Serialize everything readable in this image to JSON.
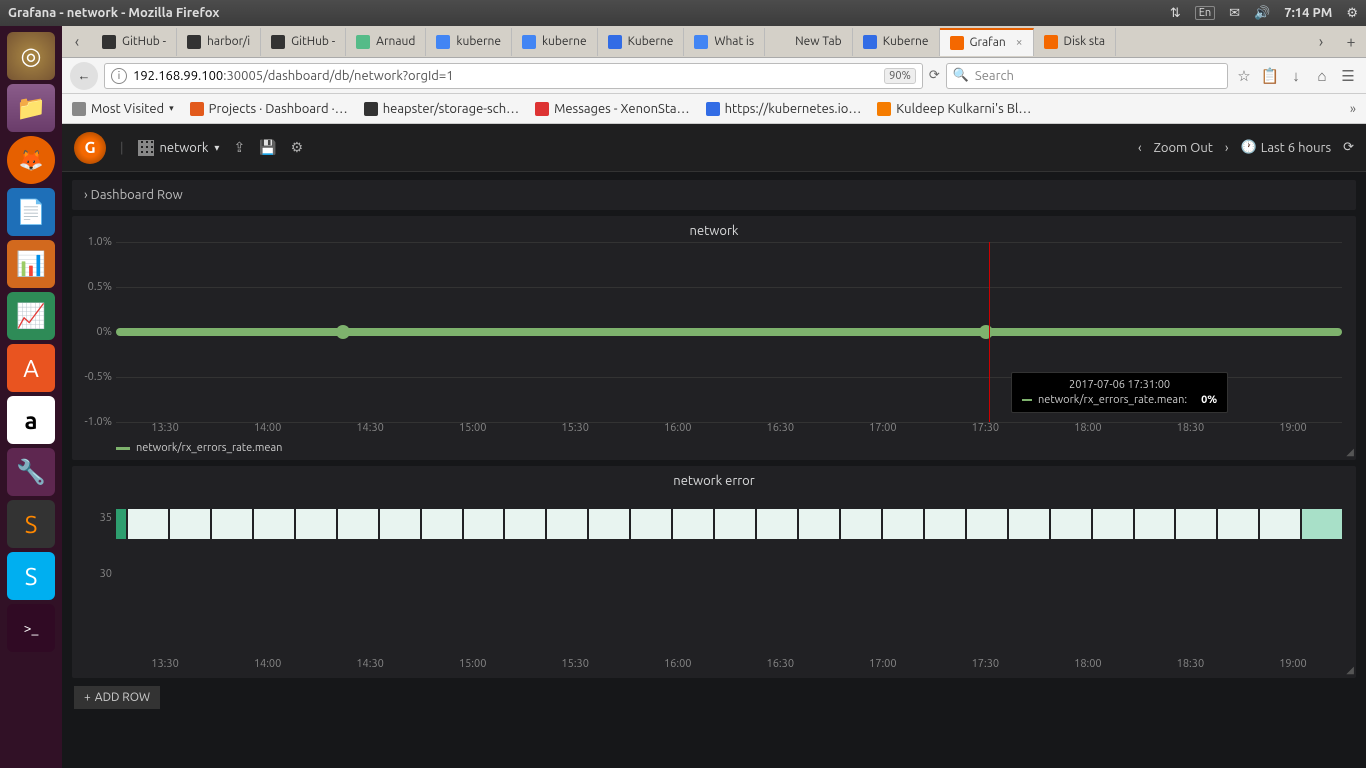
{
  "os": {
    "window_title": "Grafana - network - Mozilla Firefox",
    "indicators": {
      "net": "⇅",
      "lang": "En",
      "mail": "✉",
      "sound": "🔊",
      "time": "7:14 PM",
      "gear": "⚙"
    }
  },
  "launcher": [
    {
      "name": "dash",
      "glyph": "◎"
    },
    {
      "name": "files",
      "glyph": "📁"
    },
    {
      "name": "firefox",
      "glyph": "🦊"
    },
    {
      "name": "writer",
      "glyph": "📄"
    },
    {
      "name": "impress",
      "glyph": "📊"
    },
    {
      "name": "calc",
      "glyph": "📈"
    },
    {
      "name": "software",
      "glyph": "A"
    },
    {
      "name": "amazon",
      "glyph": "a"
    },
    {
      "name": "settings",
      "glyph": "🔧"
    },
    {
      "name": "sublime",
      "glyph": "S"
    },
    {
      "name": "skype",
      "glyph": "S"
    },
    {
      "name": "terminal",
      "glyph": ">_"
    }
  ],
  "tabs": [
    {
      "label": "GitHub -",
      "color": "#333"
    },
    {
      "label": "harbor/i",
      "color": "#333"
    },
    {
      "label": "GitHub -",
      "color": "#333"
    },
    {
      "label": "Arnaud",
      "color": "#5b8"
    },
    {
      "label": "kuberne",
      "color": "#4285f4"
    },
    {
      "label": "kuberne",
      "color": "#4285f4"
    },
    {
      "label": "Kuberne",
      "color": "#326ce5"
    },
    {
      "label": "What is",
      "color": "#4285f4"
    },
    {
      "label": "New Tab",
      "color": "transparent"
    },
    {
      "label": "Kuberne",
      "color": "#326ce5"
    },
    {
      "label": "Grafan",
      "color": "#f46800",
      "active": true,
      "close": true
    },
    {
      "label": "Disk sta",
      "color": "#f46800"
    }
  ],
  "addr": {
    "url_prefix": "192.168.99.100",
    "url_rest": ":30005/dashboard/db/network?orgId=1",
    "zoom": "90%",
    "search_placeholder": "Search"
  },
  "bookmarks": [
    {
      "label": "Most Visited",
      "ico": "#888",
      "drop": true
    },
    {
      "label": "Projects · Dashboard ·…",
      "ico": "#e25a1c"
    },
    {
      "label": "heapster/storage-sch…",
      "ico": "#333"
    },
    {
      "label": "Messages - XenonSta…",
      "ico": "#d33"
    },
    {
      "label": "https://kubernetes.io…",
      "ico": "#326ce5"
    },
    {
      "label": "Kuldeep Kulkarni's Bl…",
      "ico": "#f57c00"
    }
  ],
  "grafana": {
    "dash_name": "network",
    "zoom_out": "Zoom Out",
    "time_range": "Last 6 hours",
    "row_header": "Dashboard Row",
    "add_row": "ADD ROW",
    "panel1": {
      "title": "network",
      "legend": "network/rx_errors_rate.mean",
      "tooltip_time": "2017-07-06 17:31:00",
      "tooltip_series": "network/rx_errors_rate.mean:",
      "tooltip_val": "0%"
    },
    "panel2": {
      "title": "network error"
    }
  },
  "chart_data": [
    {
      "type": "line",
      "title": "network",
      "series": [
        {
          "name": "network/rx_errors_rate.mean",
          "values": [
            0,
            0,
            0,
            0,
            0,
            0,
            0,
            0,
            0,
            0,
            0,
            0,
            0
          ]
        }
      ],
      "x": [
        "13:30",
        "14:00",
        "14:30",
        "15:00",
        "15:30",
        "16:00",
        "16:30",
        "17:00",
        "17:30",
        "18:00",
        "18:30",
        "19:00"
      ],
      "ylabel": "",
      "ylim": [
        -1.0,
        1.0
      ],
      "y_ticks": [
        "1.0%",
        "0.5%",
        "0%",
        "-0.5%",
        "-1.0%"
      ],
      "crosshair_x": "17:31",
      "tooltip": {
        "time": "2017-07-06 17:31:00",
        "series": "network/rx_errors_rate.mean",
        "value": "0%"
      }
    },
    {
      "type": "bar",
      "title": "network error",
      "x": [
        "13:30",
        "14:00",
        "14:30",
        "15:00",
        "15:30",
        "16:00",
        "16:30",
        "17:00",
        "17:30",
        "18:00",
        "18:30",
        "19:00"
      ],
      "y_ticks": [
        "35",
        "30"
      ],
      "values": [
        35,
        35,
        35,
        35,
        35,
        35,
        35,
        35,
        35,
        35,
        35,
        35,
        35,
        35,
        35,
        35,
        35,
        35,
        35,
        35,
        35,
        35,
        35,
        35,
        35,
        35,
        35,
        35,
        35,
        35
      ]
    }
  ]
}
